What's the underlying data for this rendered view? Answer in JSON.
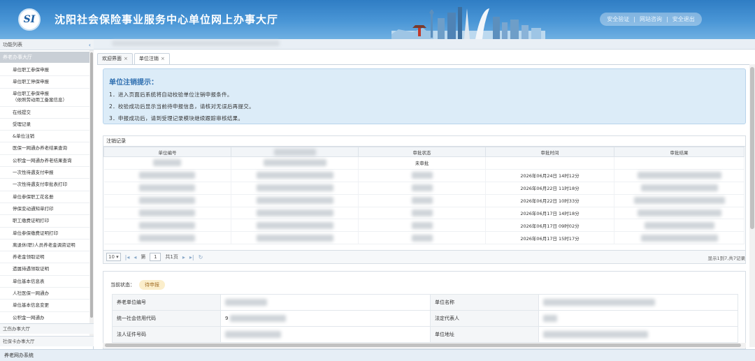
{
  "header": {
    "logo_text": "SI",
    "title": "沈阳社会保险事业服务中心单位网上办事大厅",
    "links": [
      "安全验证",
      "网站咨询",
      "安全退出"
    ],
    "link_separator": "|"
  },
  "sidebar": {
    "title": "功能列表",
    "collapse_glyph": "‹",
    "group_open": "养老办事大厅",
    "items": [
      "单位职工参保申报",
      "单位职工停保申报",
      "单位职工参保申报\n（依照劳动用工备案信息）",
      "在线提交",
      "受理记录",
      "&单位注销",
      "医保一网通办养老结果查询",
      "公积金一网通办养老结果查询",
      "一次性待遇支付申报",
      "一次性待遇支付审批表打印",
      "单位参保职工花名册",
      "停保变动通知单打印",
      "职工缴费证明打印",
      "单位参保缴费证明打印",
      "离退休(职)人员养老金调资证明",
      "养老金领取证明",
      "遗属待遇领取证明",
      "单位基本信息表",
      "人社医保一网通办",
      "单位基本信息变更",
      "公积金一网通办"
    ],
    "group_collapsed": [
      "工伤办事大厅",
      "社保卡办事大厅"
    ]
  },
  "tabs": [
    {
      "label": "欢迎界面",
      "close": "×"
    },
    {
      "label": "单位注销",
      "close": "×"
    }
  ],
  "hint": {
    "title": "单位注销提示：",
    "lines": [
      "1．进入页面后系统将自动校验单位注销申报条件。",
      "2．校验成功后显示当前待申报信息，请核对无误后再提交。",
      "3．申报成功后，请到受理记录模块继续跟踪审核结果。"
    ]
  },
  "records": {
    "title": "注销记录",
    "columns": [
      "单位编号",
      "",
      "审批状态",
      "审批时间",
      "审批结果"
    ],
    "rows": [
      {
        "status": "未审批",
        "time": ""
      },
      {
        "status": "",
        "time": "2026年06月24日 14时12分"
      },
      {
        "status": "",
        "time": "2026年06月22日 11时18分"
      },
      {
        "status": "",
        "time": "2026年06月22日 10时33分"
      },
      {
        "status": "",
        "time": "2026年06月17日 14时18分"
      },
      {
        "status": "",
        "time": "2026年06月17日 09时02分"
      },
      {
        "status": "",
        "time": "2026年06月17日 15时17分"
      }
    ]
  },
  "pager": {
    "page_size": "10",
    "page_label": "第",
    "page_value": "1",
    "total_pages": "共1页",
    "info": "显示1到7,共7记录",
    "first": "|◂",
    "prev": "◂",
    "next": "▸",
    "last": "▸|",
    "refresh": "↻"
  },
  "detail": {
    "status_label": "当前状态：",
    "status_value": "待申报",
    "fields": [
      {
        "label": "养老单位编号",
        "label2": "单位名称"
      },
      {
        "label": "统一社会信用代码",
        "label2": "法定代表人",
        "value_prefix": "9"
      },
      {
        "label": "法人证件号码",
        "label2": "单位地址"
      }
    ]
  },
  "footer": {
    "text": "养老网办系统"
  },
  "colors": {
    "header_blue": "#2f7dc4",
    "hint_bg": "#dcecf8",
    "hint_title": "#2f6fb0",
    "badge_bg": "#fbeecb"
  }
}
